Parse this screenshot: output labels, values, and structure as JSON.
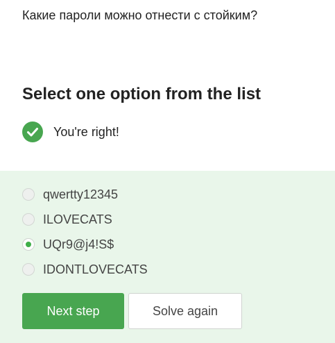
{
  "question": {
    "text": "Какие пароли можно отнести с стойким?"
  },
  "task": {
    "heading": "Select one option from the list"
  },
  "feedback": {
    "icon": "check-circle-icon",
    "text": "You're right!",
    "color": "#48a650"
  },
  "options": [
    {
      "label": "qwertty12345",
      "selected": false
    },
    {
      "label": "ILOVECATS",
      "selected": false
    },
    {
      "label": "UQr9@j4!S$",
      "selected": true
    },
    {
      "label": "IDONTLOVECATS",
      "selected": false
    }
  ],
  "buttons": {
    "next_label": "Next step",
    "solve_again_label": "Solve again"
  },
  "colors": {
    "accent": "#48a650",
    "panel_background": "#e9f6ea"
  }
}
